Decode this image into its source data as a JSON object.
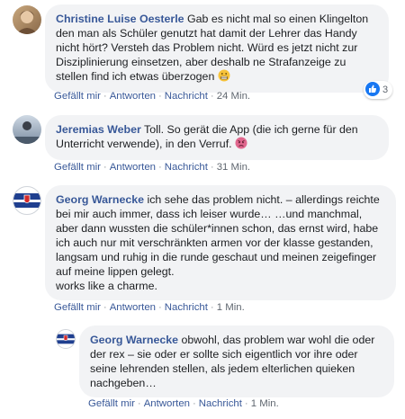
{
  "comments": [
    {
      "author": "Christine Luise Oesterle",
      "text": "Gab es nicht mal so einen Klingelton den man als Schüler genutzt hat damit der Lehrer das Handy nicht hört? Versteh das Problem nicht. Würd es jetzt nicht zur Disziplinierung einsetzen, aber deshalb ne Strafanzeige zu stellen find ich etwas überzogen",
      "emoji": "grimacing-face-icon",
      "reactions": "3",
      "time": "24 Min."
    },
    {
      "author": "Jeremias Weber",
      "text": "Toll. So gerät die App (die ich gerne für den Unterricht verwende), in den Verruf.",
      "emoji": "angry-face-icon",
      "time": "31 Min."
    },
    {
      "author": "Georg Warnecke",
      "text": "ich sehe das problem nicht. – allerdings reichte bei mir auch immer, dass ich leiser wurde… …und manchmal, aber dann wussten die schüler*innen schon, das ernst wird, habe ich auch nur mit verschränkten armen vor der klasse gestanden, langsam und ruhig in die runde geschaut und meinen zeigefinger auf meine lippen gelegt.",
      "text2": "works like a charme.",
      "time": "1 Min."
    },
    {
      "author": "Georg Warnecke",
      "text": "obwohl, das problem war wohl die oder der rex – sie oder er sollte sich eigentlich vor ihre oder seine lehrenden stellen, als jedem elterlichen quieken nachgeben…",
      "time": "1 Min."
    }
  ],
  "actions": {
    "like": "Gefällt mir",
    "reply": "Antworten",
    "message": "Nachricht"
  },
  "colors": {
    "link": "#385898",
    "bubble": "#f2f3f5",
    "meta": "#606770"
  }
}
